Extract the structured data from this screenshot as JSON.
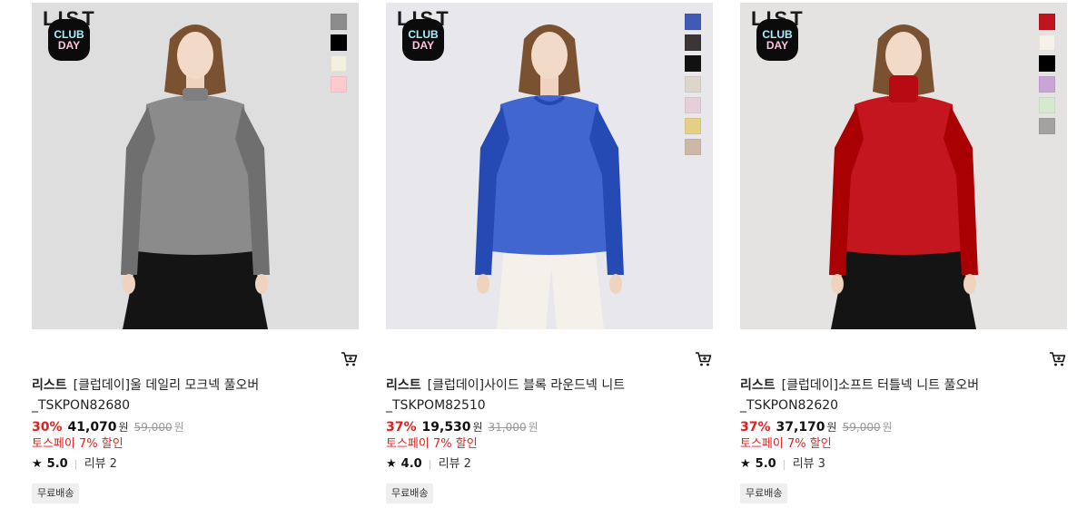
{
  "products": [
    {
      "brand": "리스트",
      "watermark": "LIST",
      "club_badge": [
        "CLUB",
        "DAY"
      ],
      "name_line1": "[클럽데이]울 데일리 모크넥 풀오버",
      "name_line2": "_TSKPON82680",
      "discount": "30%",
      "price": "41,070",
      "currency": "원",
      "original_price": "59,000",
      "toss_text": "토스페이 7% 할인",
      "rating": "5.0",
      "review_label": "리뷰",
      "review_count": "2",
      "shipping_badge": "무료배송",
      "swatches": [
        "#8c8c8c",
        "#000000",
        "#f4f0df",
        "#ffc9d0"
      ],
      "garment_color": "#8b8b8b",
      "background_color": "#dedede",
      "neck_style": "mock",
      "bottom_style": "dark-skirt",
      "cart_icon": "cart-add-icon"
    },
    {
      "brand": "리스트",
      "watermark": "LIST",
      "club_badge": [
        "CLUB",
        "DAY"
      ],
      "name_line1": "[클럽데이]사이드 블록 라운드넥 니트",
      "name_line2": "_TSKPOM82510",
      "discount": "37%",
      "price": "19,530",
      "currency": "원",
      "original_price": "31,000",
      "toss_text": "토스페이 7% 할인",
      "rating": "4.0",
      "review_label": "리뷰",
      "review_count": "2",
      "shipping_badge": "무료배송",
      "swatches": [
        "#3f5bb5",
        "#3b3536",
        "#111111",
        "#dcd6cb",
        "#e5cfd9",
        "#e3cf85",
        "#cdb8a8"
      ],
      "garment_color": "#4166d0",
      "background_color": "#e8e8ec",
      "neck_style": "round",
      "bottom_style": "white-pants",
      "cart_icon": "cart-add-icon"
    },
    {
      "brand": "리스트",
      "watermark": "LIST",
      "club_badge": [
        "CLUB",
        "DAY"
      ],
      "name_line1": "[클럽데이]소프트 터틀넥 니트 풀오버",
      "name_line2": "_TSKPON82620",
      "discount": "37%",
      "price": "37,170",
      "currency": "원",
      "original_price": "59,000",
      "toss_text": "토스페이 7% 할인",
      "rating": "5.0",
      "review_label": "리뷰",
      "review_count": "3",
      "shipping_badge": "무료배송",
      "swatches": [
        "#c0141e",
        "#f6f1ea",
        "#000000",
        "#c9a4d6",
        "#d4e9cd",
        "#a2a2a2"
      ],
      "garment_color": "#c4161f",
      "background_color": "#e5e3e1",
      "neck_style": "turtle",
      "bottom_style": "dark-skirt",
      "cart_icon": "cart-add-icon"
    }
  ]
}
